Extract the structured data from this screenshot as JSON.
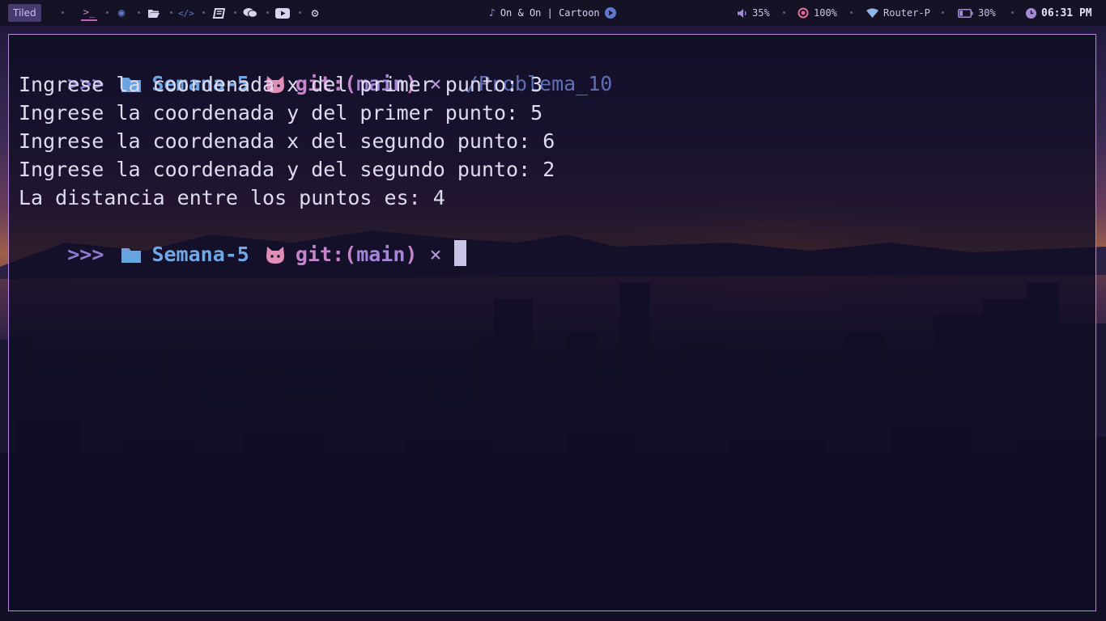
{
  "topbar": {
    "layout": "Tiled",
    "workspaces": [
      {
        "name": "terminal-icon",
        "glyph": ">_",
        "active": true
      },
      {
        "name": "firefox-icon",
        "glyph": "◉",
        "active": false
      },
      {
        "name": "folder-open-icon",
        "glyph": "📂",
        "active": false
      },
      {
        "name": "code-icon",
        "glyph": "</>",
        "active": false
      },
      {
        "name": "book-icon",
        "glyph": "▤",
        "active": false
      },
      {
        "name": "chat-icon",
        "glyph": "💬",
        "active": false
      },
      {
        "name": "youtube-icon",
        "glyph": "▶",
        "active": false
      },
      {
        "name": "gear-icon",
        "glyph": "⚙",
        "active": false
      }
    ],
    "now_playing": "On & On | Cartoon",
    "volume": "35%",
    "brightness": "100%",
    "network": "Router-P",
    "battery": "30%",
    "battery_level": 0.3,
    "clock": "06:31 PM"
  },
  "terminal": {
    "prompt_symbol": ">>>",
    "directory": "Semana-5",
    "git_label": "git:",
    "paren_open": "(",
    "branch": "main",
    "paren_close": ")",
    "dirty_mark": "×",
    "command": "./Problema_10",
    "output": [
      "Ingrese la coordenada x del primer punto: 3",
      "Ingrese la coordenada y del primer punto: 5",
      "Ingrese la coordenada x del segundo punto: 6",
      "Ingrese la coordenada y del segundo punto: 2",
      "La distancia entre los puntos es: 4"
    ]
  },
  "colors": {
    "accent": "#b988d8",
    "topbar_bg": "#141224",
    "terminal_text": "#dedbee",
    "directory": "#6fa8e6",
    "git": "#c684cc"
  }
}
